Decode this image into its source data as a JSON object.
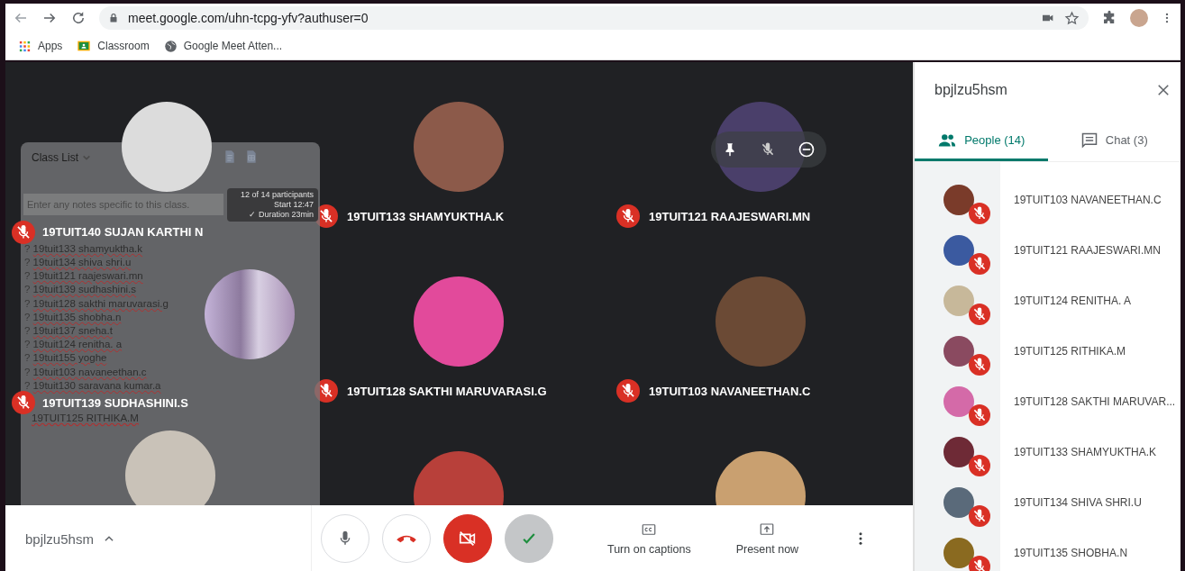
{
  "browser": {
    "url": "meet.google.com/uhn-tcpg-yfv?authuser=0",
    "bookmarks": [
      {
        "label": "Apps",
        "kind": "apps"
      },
      {
        "label": "Classroom",
        "kind": "classroom"
      },
      {
        "label": "Google Meet Atten...",
        "kind": "globe"
      }
    ]
  },
  "class_list": {
    "title": "Class List",
    "notes_placeholder": "Enter any notes specific to this class.",
    "stats": [
      "12 of 14 participants",
      "Start 12:47",
      "✓ Duration 23min"
    ],
    "entries": [
      {
        "prefix": "?",
        "student": "19tuit133 shamyuktha.k"
      },
      {
        "prefix": "?",
        "student": "19tuit134 shiva shri.u"
      },
      {
        "prefix": "?",
        "student": "19tuit121 raajeswari.mn"
      },
      {
        "prefix": "?",
        "student": "19tuit139 sudhashini.s"
      },
      {
        "prefix": "?",
        "student": "19tuit128 sakthi maruvarasi.g"
      },
      {
        "prefix": "?",
        "student": "19tuit135 shobha.n"
      },
      {
        "prefix": "?",
        "student": "19tuit137 sneha.t"
      },
      {
        "prefix": "?",
        "student": "19tuit124 renitha. a"
      },
      {
        "prefix": "?",
        "student": "19tuit155 yoghe"
      },
      {
        "prefix": "?",
        "student": "19tuit103 navaneethan.c"
      },
      {
        "prefix": "?",
        "student": "19tuit130 saravana kumar.a"
      }
    ],
    "footer_entry": "19TUIT125 RITHIKA.M"
  },
  "tiles": [
    {
      "name": "19TUIT140 SUJAN KARTHI N",
      "muted": true,
      "hover_controls": false
    },
    {
      "name": "19TUIT133 SHAMYUKTHA.K",
      "muted": true,
      "hover_controls": false
    },
    {
      "name": "19TUIT121 RAAJESWARI.MN",
      "muted": true,
      "hover_controls": true
    },
    {
      "name": "19TUIT139 SUDHASHINI.S",
      "muted": true,
      "hover_controls": false
    },
    {
      "name": "19TUIT128 SAKTHI MARUVARASI.G",
      "muted": true,
      "hover_controls": false
    },
    {
      "name": "19TUIT103 NAVANEETHAN.C",
      "muted": true,
      "hover_controls": false
    },
    {
      "hover_controls": false
    },
    {
      "hover_controls": false
    },
    {
      "hover_controls": false
    }
  ],
  "sidebar": {
    "title": "bpjlzu5hsm",
    "tabs": [
      {
        "label": "People (14)",
        "kind": "people",
        "selected": true
      },
      {
        "label": "Chat (3)",
        "kind": "chat",
        "selected": false
      }
    ],
    "people": [
      {
        "name": "19TUIT103 NAVANEETHAN.C",
        "muted": true
      },
      {
        "name": "19TUIT121 RAAJESWARI.MN",
        "muted": true
      },
      {
        "name": "19TUIT124 RENITHA. A",
        "muted": true
      },
      {
        "name": "19TUIT125 RITHIKA.M",
        "muted": true
      },
      {
        "name": "19TUIT128 SAKTHI MARUVAR...",
        "muted": true
      },
      {
        "name": "19TUIT133 SHAMYUKTHA.K",
        "muted": true
      },
      {
        "name": "19TUIT134 SHIVA SHRI.U",
        "muted": true
      },
      {
        "name": "19TUIT135 SHOBHA.N",
        "muted": true
      }
    ]
  },
  "controls": {
    "meeting_code": "bpjlzu5hsm",
    "camera_off": true,
    "actions": [
      {
        "label": "Turn on captions",
        "kind": "captions"
      },
      {
        "label": "Present now",
        "kind": "present"
      }
    ]
  }
}
